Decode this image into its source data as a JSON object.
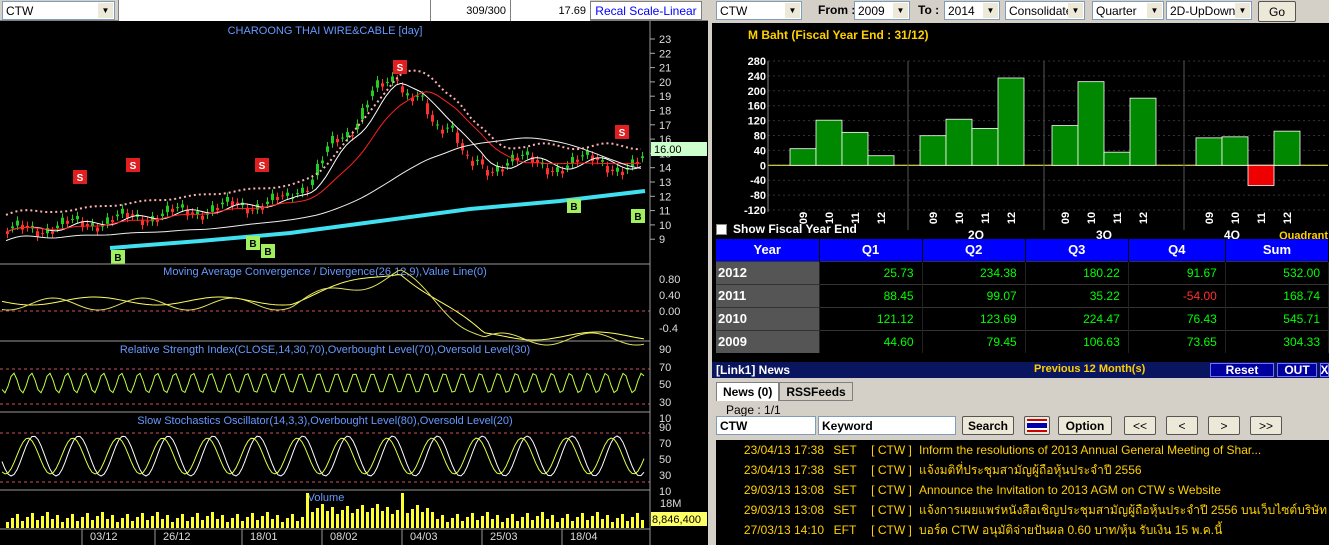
{
  "left": {
    "symbol": "CTW",
    "cell1": "",
    "cell2": "309/300",
    "cell3": "17.69",
    "recal": "Recal Scale-Linear",
    "title": "CHAROONG THAI WIRE&CABLE [day]",
    "last_price": "16.00",
    "volume_value": "8,846,400",
    "price_axis": [
      "23",
      "22",
      "21",
      "20",
      "19",
      "18",
      "17",
      "16",
      "15",
      "14",
      "13",
      "12",
      "11",
      "10",
      "9"
    ],
    "macd_label": "Moving Average Convergence / Divergence(26,12,9),Value Line(0)",
    "macd_axis": [
      "0.80",
      "0.40",
      "0.00",
      "-0.4"
    ],
    "rsi_label": "Relative Strength Index(CLOSE,14,30,70),Overbought Level(70),Oversold Level(30)",
    "rsi_axis": [
      "90",
      "70",
      "50",
      "30",
      "10"
    ],
    "stoch_label": "Slow Stochastics Oscillator(14,3,3),Overbought Level(80),Oversold Level(20)",
    "stoch_axis": [
      "90",
      "70",
      "50",
      "30",
      "10"
    ],
    "volume_label": "Volume",
    "volume_axis": [
      "18M"
    ],
    "date_labels": [
      "03/12",
      "26/12",
      "18/01",
      "08/02",
      "04/03",
      "25/03",
      "18/04"
    ],
    "signals_s": [
      "S",
      "S",
      "S",
      "S",
      "S"
    ],
    "signals_b": [
      "B",
      "B",
      "B",
      "B",
      "B"
    ]
  },
  "right": {
    "symbol": "CTW",
    "from_label": "From :",
    "from_value": "2009",
    "to_label": "To :",
    "to_value": "2014",
    "mode": "Consolidated",
    "period": "Quarter",
    "view": "2D-UpDown",
    "go_label": "Go",
    "chart_title": "M Baht  (Fiscal Year End : 31/12)",
    "y_axis": [
      "280",
      "240",
      "200",
      "160",
      "120",
      "80",
      "40",
      "0",
      "-40",
      "-80",
      "-120"
    ],
    "quarter_labels": [
      "2Q",
      "3Q",
      "4Q"
    ],
    "quadrant_label": "Quadrant",
    "show_fy_label": "Show Fiscal Year End",
    "table_headers": [
      "Year",
      "Q1",
      "Q2",
      "Q3",
      "Q4",
      "Sum"
    ],
    "table_rows": [
      {
        "year": "2012",
        "q1": "25.73",
        "q2": "234.38",
        "q3": "180.22",
        "q4": "91.67",
        "sum": "532.00"
      },
      {
        "year": "2011",
        "q1": "88.45",
        "q2": "99.07",
        "q3": "35.22",
        "q4": "-54.00",
        "sum": "168.74"
      },
      {
        "year": "2010",
        "q1": "121.12",
        "q2": "123.69",
        "q3": "224.47",
        "q4": "76.43",
        "sum": "545.71"
      },
      {
        "year": "2009",
        "q1": "44.60",
        "q2": "79.45",
        "q3": "106.63",
        "q4": "73.65",
        "sum": "304.33"
      }
    ],
    "news_bar_title": "[Link1] News",
    "news_prev": "Previous 12 Month(s)",
    "reset_label": "Reset",
    "out_label": "OUT",
    "close_label": "X",
    "tab_news": "News (0)",
    "tab_rss": "RSSFeeds",
    "page_label": "Page : 1/1",
    "search_symbol": "CTW",
    "keyword_placeholder": "Keyword",
    "search_label": "Search",
    "option_label": "Option",
    "nav_first": "<<",
    "nav_prev": "<",
    "nav_next": ">",
    "nav_last": ">>",
    "news": [
      {
        "date": "23/04/13 17:38",
        "src": "SET",
        "sym": "[ CTW ]",
        "head": "Inform the resolutions of 2013 Annual General Meeting of Shar..."
      },
      {
        "date": "23/04/13 17:38",
        "src": "SET",
        "sym": "[ CTW ]",
        "head": "แจ้งมติที่ประชุมสามัญผู้ถือหุ้นประจำปี 2556"
      },
      {
        "date": "29/03/13 13:08",
        "src": "SET",
        "sym": "[ CTW ]",
        "head": "Announce the Invitation to 2013 AGM on CTW s Website"
      },
      {
        "date": "29/03/13 13:08",
        "src": "SET",
        "sym": "[ CTW ]",
        "head": "แจ้งการเผยแพร่หนังสือเชิญประชุมสามัญผู้ถือหุ้นประจำปี 2556 บนเว็บไซต์บริษัท"
      },
      {
        "date": "27/03/13 14:10",
        "src": "EFT",
        "sym": "[ CTW ]",
        "head": "บอร์ด CTW อนุมัติจ่ายปันผล 0.60 บาท/หุ้น รับเงิน 15 พ.ค.นี้"
      }
    ]
  },
  "chart_data": {
    "type": "bar",
    "title": "M Baht  (Fiscal Year End : 31/12)",
    "ylim": [
      -120,
      280
    ],
    "categories": [
      "Q1",
      "Q2",
      "Q3",
      "Q4"
    ],
    "series": [
      {
        "name": "2009",
        "values": [
          44.6,
          79.45,
          106.63,
          73.65
        ]
      },
      {
        "name": "2010",
        "values": [
          121.12,
          123.69,
          224.47,
          76.43
        ]
      },
      {
        "name": "2011",
        "values": [
          88.45,
          99.07,
          35.22,
          -54.0
        ]
      },
      {
        "name": "2012",
        "values": [
          25.73,
          234.38,
          180.22,
          91.67
        ]
      }
    ],
    "x_tick_labels": [
      "09",
      "10",
      "11",
      "12"
    ]
  }
}
